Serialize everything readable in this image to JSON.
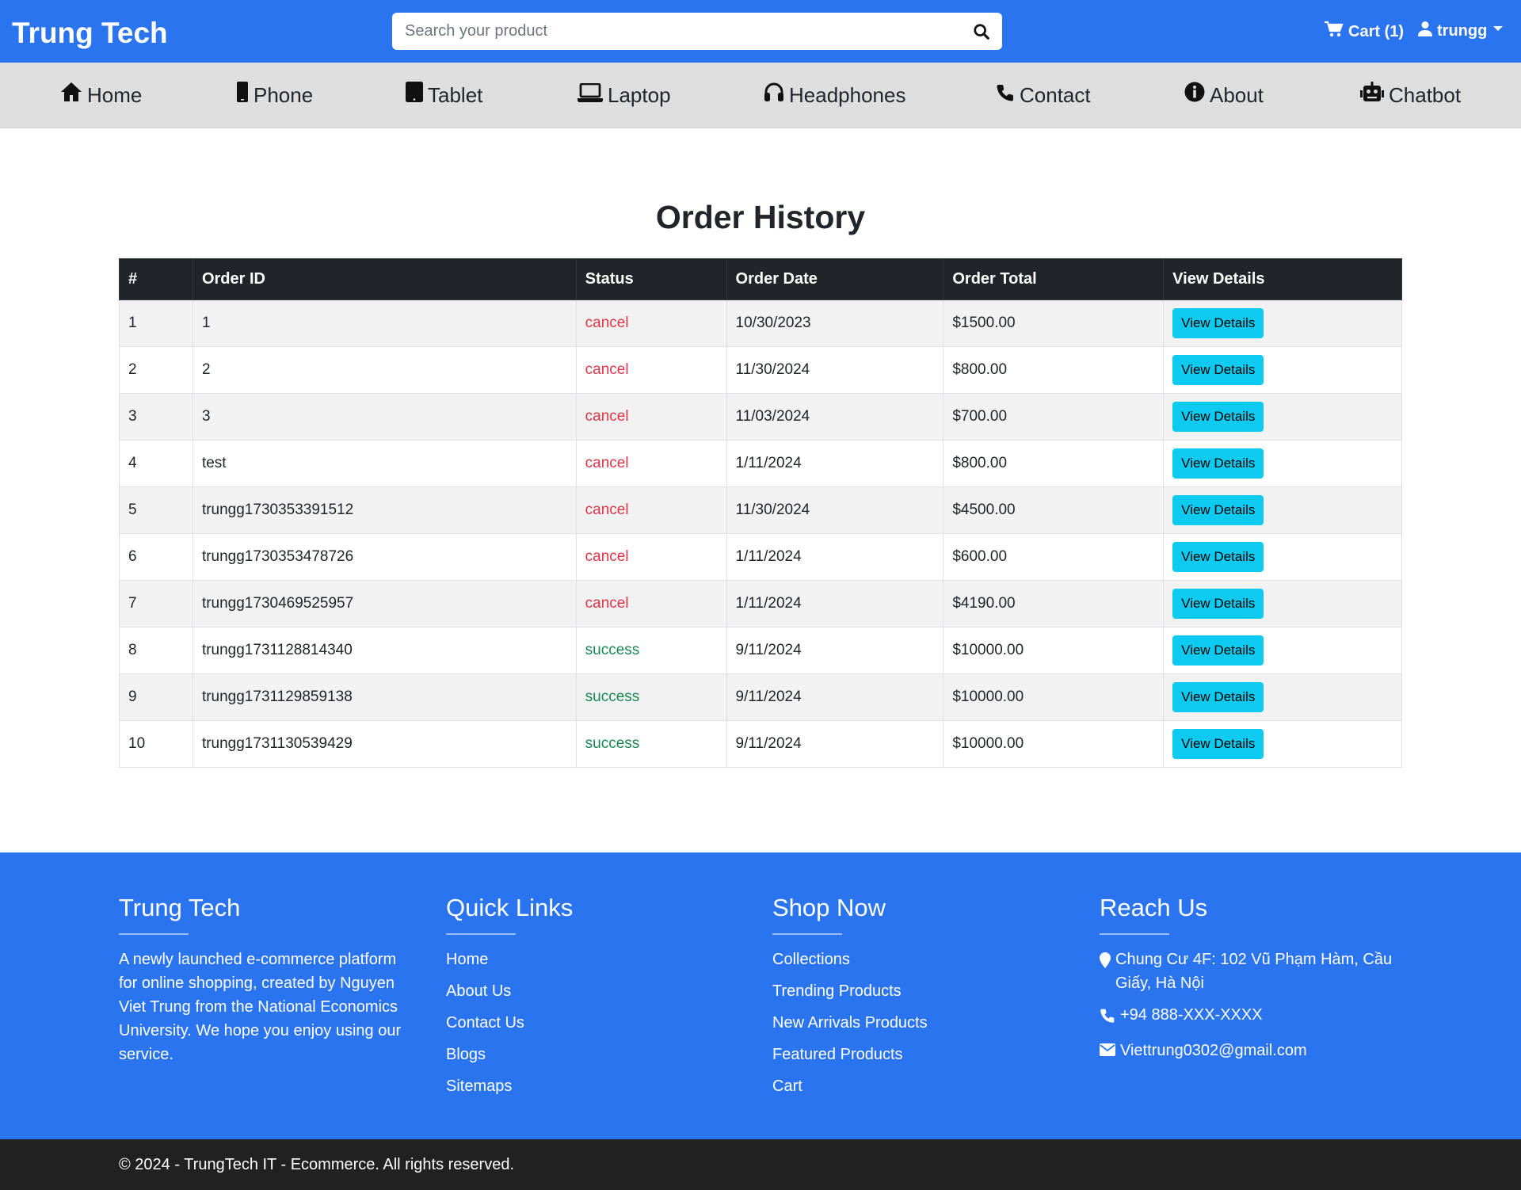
{
  "header": {
    "brand": "Trung Tech",
    "search_placeholder": "Search your product",
    "cart_label": "Cart (1)",
    "user_label": "trungg"
  },
  "nav": [
    {
      "label": "Home",
      "icon": "home-icon"
    },
    {
      "label": "Phone",
      "icon": "phone-icon"
    },
    {
      "label": "Tablet",
      "icon": "tablet-icon"
    },
    {
      "label": "Laptop",
      "icon": "laptop-icon"
    },
    {
      "label": "Headphones",
      "icon": "headphones-icon"
    },
    {
      "label": "Contact",
      "icon": "phone-handset-icon"
    },
    {
      "label": "About",
      "icon": "info-icon"
    },
    {
      "label": "Chatbot",
      "icon": "robot-icon"
    }
  ],
  "page": {
    "title": "Order History"
  },
  "table": {
    "headers": [
      "#",
      "Order ID",
      "Status",
      "Order Date",
      "Order Total",
      "View Details"
    ],
    "button_label": "View Details",
    "rows": [
      {
        "num": "1",
        "order_id": "1",
        "status": "cancel",
        "date": "10/30/2023",
        "total": "$1500.00"
      },
      {
        "num": "2",
        "order_id": "2",
        "status": "cancel",
        "date": "11/30/2024",
        "total": "$800.00"
      },
      {
        "num": "3",
        "order_id": "3",
        "status": "cancel",
        "date": "11/03/2024",
        "total": "$700.00"
      },
      {
        "num": "4",
        "order_id": "test",
        "status": "cancel",
        "date": "1/11/2024",
        "total": "$800.00"
      },
      {
        "num": "5",
        "order_id": "trungg1730353391512",
        "status": "cancel",
        "date": "11/30/2024",
        "total": "$4500.00"
      },
      {
        "num": "6",
        "order_id": "trungg1730353478726",
        "status": "cancel",
        "date": "1/11/2024",
        "total": "$600.00"
      },
      {
        "num": "7",
        "order_id": "trungg1730469525957",
        "status": "cancel",
        "date": "1/11/2024",
        "total": "$4190.00"
      },
      {
        "num": "8",
        "order_id": "trungg1731128814340",
        "status": "success",
        "date": "9/11/2024",
        "total": "$10000.00"
      },
      {
        "num": "9",
        "order_id": "trungg1731129859138",
        "status": "success",
        "date": "9/11/2024",
        "total": "$10000.00"
      },
      {
        "num": "10",
        "order_id": "trungg1731130539429",
        "status": "success",
        "date": "9/11/2024",
        "total": "$10000.00"
      }
    ]
  },
  "footer": {
    "about": {
      "title": "Trung Tech",
      "text": "A newly launched e-commerce platform for online shopping, created by Nguyen Viet Trung from the National Economics University. We hope you enjoy using our service."
    },
    "quick_links": {
      "title": "Quick Links",
      "items": [
        "Home",
        "About Us",
        "Contact Us",
        "Blogs",
        "Sitemaps"
      ]
    },
    "shop_now": {
      "title": "Shop Now",
      "items": [
        "Collections",
        "Trending Products",
        "New Arrivals Products",
        "Featured Products",
        "Cart"
      ]
    },
    "reach_us": {
      "title": "Reach Us",
      "address": "Chung Cư 4F: 102 Vũ Phạm Hàm, Cầu Giấy, Hà Nội",
      "phone": "+94 888-XXX-XXXX",
      "email": "Viettrung0302@gmail.com"
    },
    "copyright": "© 2024 - TrungTech IT - Ecommerce. All rights reserved."
  },
  "colors": {
    "brand_blue": "#2b74f0",
    "nav_gray": "#dedede",
    "table_header": "#212529",
    "cancel": "#dc3545",
    "success": "#198754",
    "button": "#0dcaf0",
    "bottom_bar": "#212121"
  }
}
